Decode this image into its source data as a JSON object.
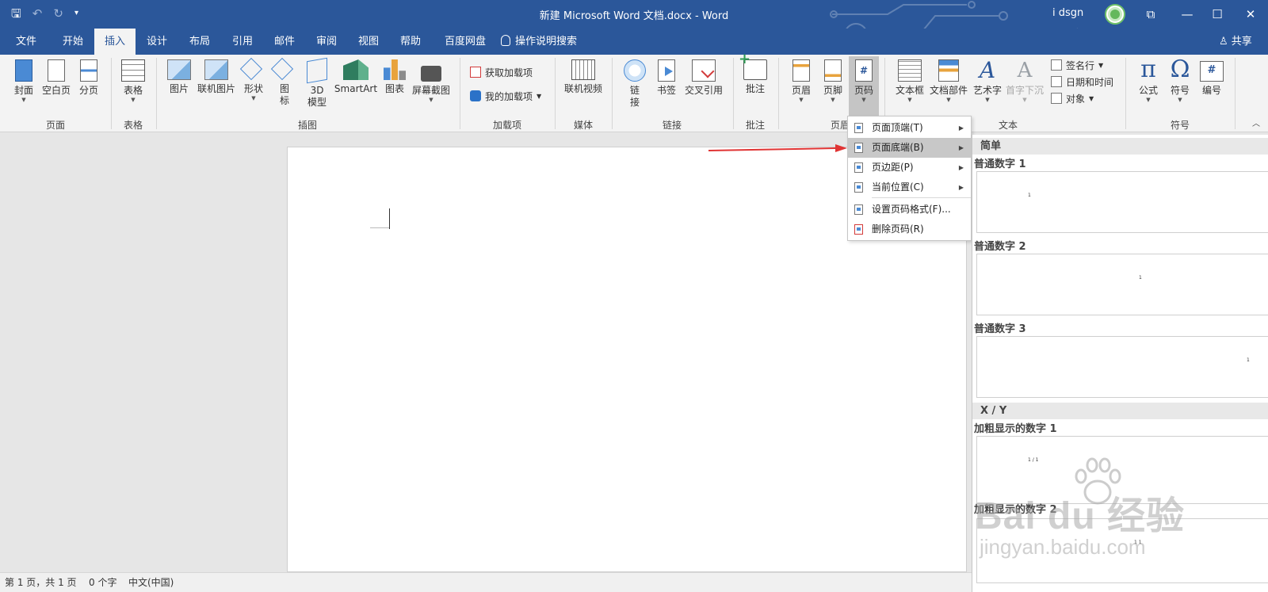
{
  "titlebar": {
    "document_title": "新建 Microsoft Word 文档.docx  -  Word",
    "user_name": "i dsgn",
    "qat": {
      "save_icon": "save-icon",
      "undo_icon": "undo-icon",
      "redo_icon": "redo-icon",
      "customize_icon": "chevron-down-icon"
    },
    "window_buttons": {
      "ribbon_options": "⧉",
      "minimize": "—",
      "maximize": "☐",
      "close": "✕"
    }
  },
  "tabs": [
    {
      "label": "文件"
    },
    {
      "label": "开始"
    },
    {
      "label": "插入"
    },
    {
      "label": "设计"
    },
    {
      "label": "布局"
    },
    {
      "label": "引用"
    },
    {
      "label": "邮件"
    },
    {
      "label": "审阅"
    },
    {
      "label": "视图"
    },
    {
      "label": "帮助"
    },
    {
      "label": "百度网盘"
    }
  ],
  "active_tab": "插入",
  "tell_me": "操作说明搜索",
  "share": "共享",
  "ribbon": {
    "pages": {
      "cover": "封面",
      "blank": "空白页",
      "break": "分页",
      "group": "页面"
    },
    "tables": {
      "table": "表格",
      "group": "表格"
    },
    "illustrations": {
      "picture": "图片",
      "online_picture": "联机图片",
      "shapes": "形状",
      "icons_line1": "图",
      "icons_line2": "标",
      "model_line1": "3D",
      "model_line2": "模型",
      "smartart": "SmartArt",
      "chart": "图表",
      "screenshot": "屏幕截图",
      "group": "插图"
    },
    "addins": {
      "get": "获取加载项",
      "mine": "我的加载项",
      "group": "加载项"
    },
    "media": {
      "video": "联机视频",
      "group": "媒体"
    },
    "links": {
      "link_line1": "链",
      "link_line2": "接",
      "bookmark": "书签",
      "xref": "交叉引用",
      "group": "链接"
    },
    "comments": {
      "comment": "批注",
      "group": "批注"
    },
    "header_footer": {
      "header": "页眉",
      "footer": "页脚",
      "page_number": "页码",
      "group": "页眉和页"
    },
    "text": {
      "textbox": "文本框",
      "quick_parts": "文档部件",
      "wordart": "艺术字",
      "dropcap": "首字下沉",
      "signature": "签名行",
      "datetime": "日期和时间",
      "object": "对象",
      "group": "文本"
    },
    "symbols": {
      "equation": "公式",
      "symbol": "符号",
      "number": "编号",
      "group": "符号"
    }
  },
  "dropdown": {
    "items": [
      {
        "label": "页面顶端(T)",
        "has_submenu": true
      },
      {
        "label": "页面底端(B)",
        "has_submenu": true
      },
      {
        "label": "页边距(P)",
        "has_submenu": true
      },
      {
        "label": "当前位置(C)",
        "has_submenu": true
      },
      {
        "label": "设置页码格式(F)...",
        "has_submenu": false
      },
      {
        "label": "删除页码(R)",
        "has_submenu": false
      }
    ],
    "highlighted": "页面底端(B)"
  },
  "gallery": {
    "section_simple": "简单",
    "plain1": "普通数字 1",
    "plain1_num": "1",
    "plain2": "普通数字 2",
    "plain2_num": "1",
    "plain3": "普通数字 3",
    "plain3_num": "1",
    "section_xy": "X / Y",
    "bold1": "加粗显示的数字 1",
    "bold1_num": "1 / 1",
    "bold2": "加粗显示的数字 2",
    "bold2_num": "1  1"
  },
  "watermark": {
    "logo": "Bai du 经验",
    "url": "jingyan.baidu.com"
  },
  "statusbar": {
    "page": "第 1 页，共 1 页",
    "words": "0 个字",
    "language": "中文(中国)"
  },
  "colors": {
    "accent": "#2b579a",
    "arrow": "#e03434",
    "highlight": "#c8c8c8"
  }
}
